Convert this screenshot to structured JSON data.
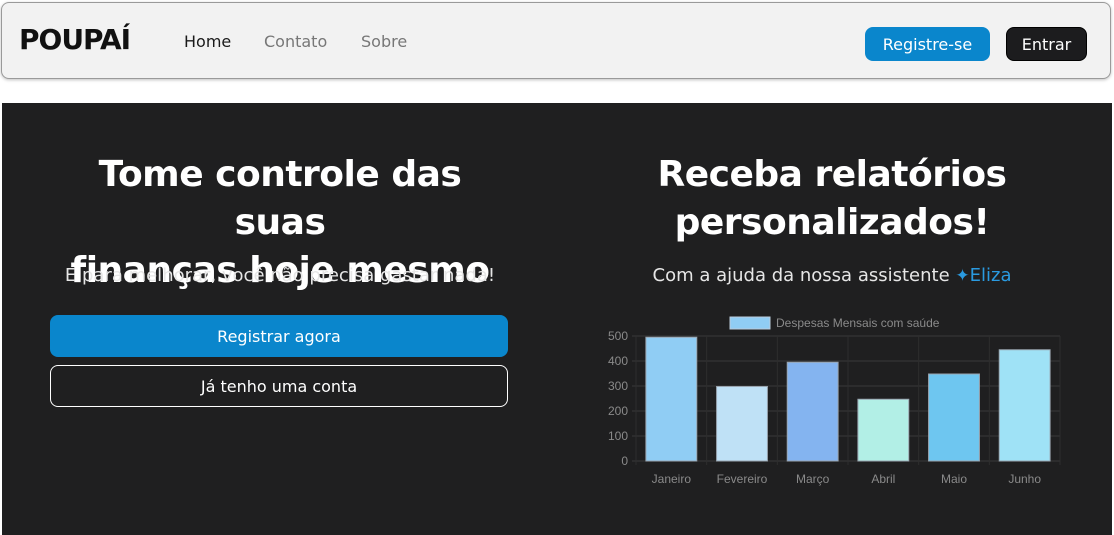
{
  "navbar": {
    "logo": "POUPAÍ",
    "links": [
      {
        "label": "Home",
        "active": true
      },
      {
        "label": "Contato",
        "active": false
      },
      {
        "label": "Sobre",
        "active": false
      }
    ],
    "register_label": "Registre-se",
    "login_label": "Entrar"
  },
  "left": {
    "title_line1": "Tome controle das suas",
    "title_line2": "finanças hoje mesmo",
    "subtitle": "E para melhorar, você não precisa gastar nada!",
    "primary_button": "Registrar agora",
    "secondary_button": "Já tenho uma conta"
  },
  "right": {
    "title_line1": "Receba relatórios",
    "title_line2": "personalizados!",
    "subtitle_prefix": "Com a ajuda da nossa assistente",
    "assistant_icon": "sparkle-icon",
    "assistant_name": "Eliza"
  },
  "colors": {
    "accent": "#0a86cc",
    "hero_bg": "#1f1f20",
    "assistant": "#2a9ae0"
  },
  "chart_data": {
    "type": "bar",
    "title": "",
    "categories": [
      "Janeiro",
      "Fevereiro",
      "Março",
      "Abril",
      "Maio",
      "Junho"
    ],
    "series": [
      {
        "name": "Despesas Mensais com saúde",
        "values": [
          495,
          298,
          395,
          247,
          348,
          445
        ]
      }
    ],
    "bar_colors": [
      "#90cdf4",
      "#bfe1f6",
      "#84b4f0",
      "#b2efe6",
      "#6ec6f0",
      "#9fe2f6"
    ],
    "ylim": [
      0,
      500
    ],
    "yticks": [
      "0",
      "100",
      "200",
      "300",
      "400",
      "500"
    ],
    "grid": true,
    "legend_position": "top"
  }
}
